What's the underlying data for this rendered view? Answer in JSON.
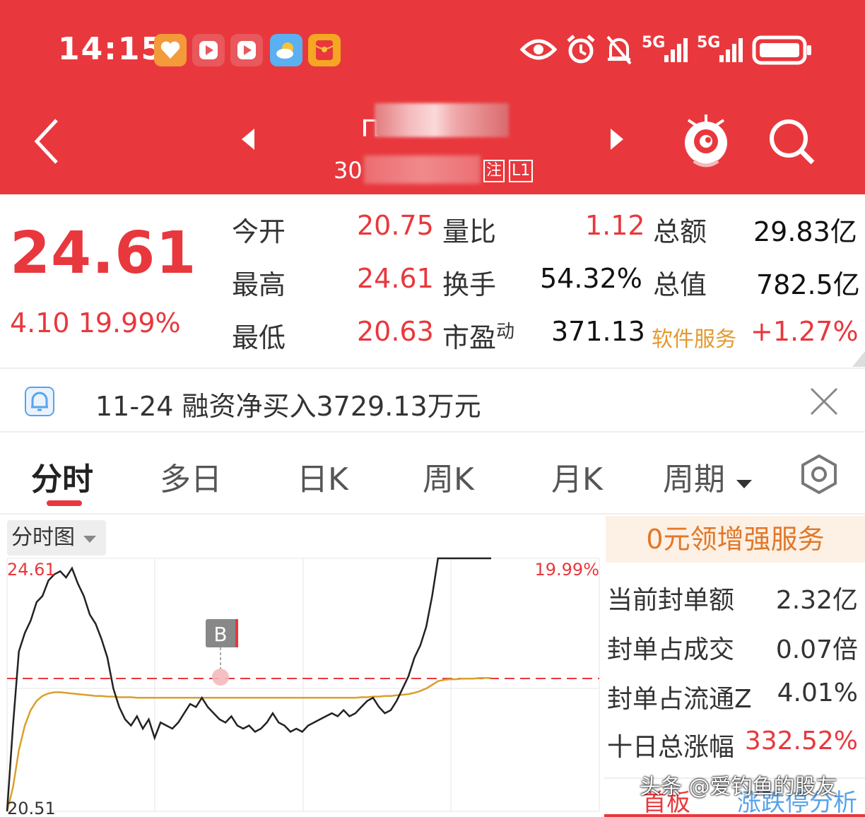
{
  "status_bar": {
    "time": "14:15",
    "network_5g_1": "5G",
    "network_5g_2": "5G",
    "icons": [
      "heart-app-icon",
      "video-app-icon",
      "video-app-icon",
      "weather-icon",
      "red-envelope-icon",
      "eye-icon",
      "alarm-icon",
      "mute-bell-icon",
      "signal-icon",
      "signal-icon",
      "battery-icon"
    ]
  },
  "header": {
    "title": "п",
    "code_prefix": "30",
    "badge_1": "注",
    "badge_2": "L1"
  },
  "quote": {
    "price": "24.61",
    "change": "4.10",
    "change_pct": "19.99%",
    "rows": [
      {
        "l1": "今开",
        "v1": "20.75",
        "l2": "量比",
        "v2": "1.12",
        "l3": "总额",
        "v3": "29.83亿"
      },
      {
        "l1": "最高",
        "v1": "24.61",
        "l2": "换手",
        "v2": "54.32%",
        "l3": "总值",
        "v3": "782.5亿"
      },
      {
        "l1": "最低",
        "v1": "20.63",
        "l2": "市盈",
        "l2_sup": "动",
        "v2": "371.13",
        "l3": "软件服务",
        "v3": "+1.27%"
      }
    ]
  },
  "notice": {
    "text": "11-24 融资净买入3729.13万元"
  },
  "tabs": [
    "分时",
    "多日",
    "日K",
    "周K",
    "月K",
    "周期"
  ],
  "chart_select": "分时图",
  "side": {
    "promo": "0元领增强服务",
    "rows": [
      {
        "k": "当前封单额",
        "v": "2.32亿"
      },
      {
        "k": "封单占成交",
        "v": "0.07倍"
      },
      {
        "k": "封单占流通Z",
        "v": "4.01%"
      },
      {
        "k": "十日总涨幅",
        "v": "332.52%"
      }
    ],
    "bottom_tab_1": "首板",
    "bottom_tab_2": "涨跌停分析"
  },
  "watermark": "头条 @爱钓鱼的股友",
  "chart_data": {
    "type": "line",
    "title": "",
    "y_labels": {
      "top_left": "24.61",
      "bottom_left": "20.51",
      "top_right": "19.99%"
    },
    "ylim": [
      20.51,
      24.61
    ],
    "prev_close": 20.51,
    "marker": "B",
    "grid": true,
    "series": [
      {
        "name": "",
        "color": "#222222",
        "values": [
          20.51,
          21.9,
          23.1,
          23.4,
          23.6,
          23.9,
          24.0,
          24.25,
          24.35,
          24.4,
          24.3,
          24.45,
          24.2,
          24.0,
          23.7,
          23.55,
          23.3,
          23.0,
          22.5,
          22.2,
          22.0,
          21.9,
          22.05,
          21.85,
          22.0,
          21.7,
          21.95,
          21.9,
          21.85,
          21.95,
          22.1,
          22.25,
          22.2,
          22.35,
          22.2,
          22.1,
          22.0,
          21.95,
          22.05,
          21.9,
          21.85,
          21.9,
          21.8,
          21.85,
          21.95,
          22.1,
          21.95,
          21.9,
          21.8,
          21.85,
          21.8,
          21.9,
          21.95,
          22.0,
          22.05,
          22.1,
          22.05,
          22.15,
          22.05,
          22.1,
          22.2,
          22.3,
          22.35,
          22.2,
          22.1,
          22.15,
          22.3,
          22.5,
          22.7,
          23.0,
          23.2,
          23.5,
          24.0,
          24.61,
          24.61,
          24.61,
          24.61,
          24.61,
          24.61,
          24.61,
          24.61,
          24.61,
          24.61
        ]
      },
      {
        "name": "",
        "color": "#d9a02c",
        "values": [
          20.51,
          20.9,
          21.5,
          21.9,
          22.15,
          22.3,
          22.38,
          22.42,
          22.44,
          22.44,
          22.43,
          22.42,
          22.41,
          22.4,
          22.39,
          22.38,
          22.38,
          22.37,
          22.37,
          22.36,
          22.36,
          22.36,
          22.35,
          22.35,
          22.35,
          22.35,
          22.35,
          22.35,
          22.35,
          22.35,
          22.35,
          22.35,
          22.35,
          22.35,
          22.35,
          22.35,
          22.35,
          22.35,
          22.35,
          22.35,
          22.35,
          22.35,
          22.35,
          22.35,
          22.35,
          22.35,
          22.35,
          22.35,
          22.35,
          22.35,
          22.35,
          22.35,
          22.35,
          22.35,
          22.35,
          22.35,
          22.35,
          22.35,
          22.35,
          22.35,
          22.36,
          22.36,
          22.37,
          22.37,
          22.38,
          22.38,
          22.39,
          22.4,
          22.41,
          22.43,
          22.46,
          22.5,
          22.56,
          22.62,
          22.64,
          22.65,
          22.65,
          22.66,
          22.66,
          22.66,
          22.67,
          22.67,
          22.67
        ]
      }
    ]
  }
}
